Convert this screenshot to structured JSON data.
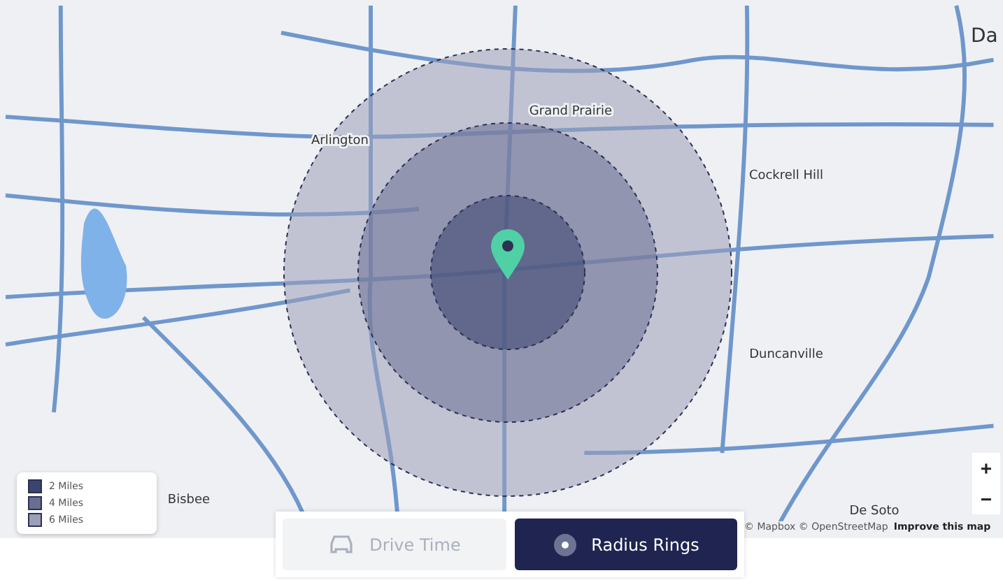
{
  "map": {
    "places": [
      "Arlington",
      "Grand Prairie",
      "Cockrell Hill",
      "Da",
      "Duncanville",
      "De Soto",
      "Bisbee"
    ],
    "attribution": "© Mapbox © OpenStreetMap",
    "improve_link": "Improve this map",
    "zoom_controls": [
      "+",
      "−"
    ]
  },
  "rings": [
    {
      "label": "2 Miles",
      "color": "#3b4370"
    },
    {
      "label": "4 Miles",
      "color": "#6a6f92"
    },
    {
      "label": "6 Miles",
      "color": "#9c9fb8"
    }
  ],
  "modes": [
    {
      "label": "Drive Time",
      "kind": "car",
      "selected": false
    },
    {
      "label": "Radius Rings",
      "kind": "ring",
      "selected": true
    }
  ]
}
